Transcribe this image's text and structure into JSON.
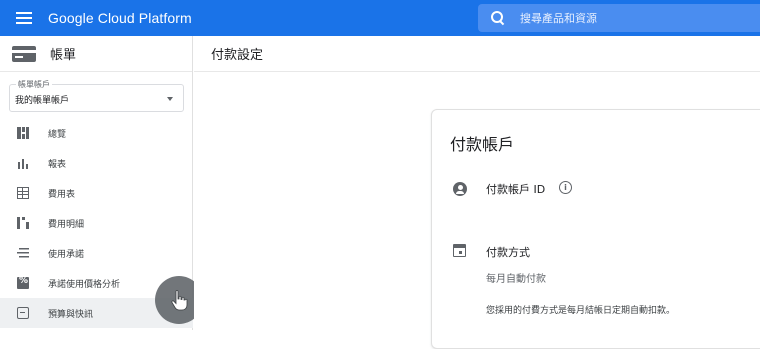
{
  "app": {
    "title": "Google Cloud Platform"
  },
  "search": {
    "placeholder": "搜尋產品和資源"
  },
  "sidebar": {
    "title": "帳單",
    "account": {
      "label": "帳單帳戶",
      "value": "我的帳單帳戶"
    },
    "items": [
      {
        "label": "總覽",
        "icon": "overview-icon"
      },
      {
        "label": "報表",
        "icon": "reports-icon"
      },
      {
        "label": "費用表",
        "icon": "cost-table-icon"
      },
      {
        "label": "費用明細",
        "icon": "cost-breakdown-icon"
      },
      {
        "label": "使用承諾",
        "icon": "commitments-icon"
      },
      {
        "label": "承諾使用價格分析",
        "icon": "pricing-icon"
      },
      {
        "label": "預算與快訊",
        "icon": "budget-icon"
      }
    ]
  },
  "main": {
    "title": "付款設定",
    "card": {
      "title": "付款帳戶",
      "id_label": "付款帳戶 ID",
      "info_glyph": "i",
      "payment_method_label": "付款方式",
      "payment_method_value": "每月自動付款",
      "payment_description": "您採用的付費方式是每月結帳日定期自動扣款。"
    }
  },
  "colors": {
    "topbar": "#1a73e8",
    "search_bg": "#4a8df0",
    "icon": "#5f6368",
    "cursor_overlay": "#5f6368"
  }
}
